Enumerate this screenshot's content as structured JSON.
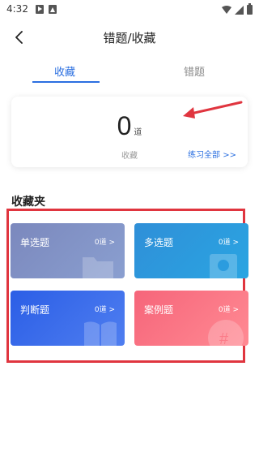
{
  "status_bar": {
    "time": "4:32",
    "icons": [
      "play-store-icon",
      "a-icon",
      "wifi-icon",
      "signal-icon",
      "battery-icon"
    ]
  },
  "header": {
    "title": "错题/收藏",
    "back_icon": "chevron-left-icon"
  },
  "tabs": [
    {
      "label": "收藏",
      "active": true
    },
    {
      "label": "错题",
      "active": false
    }
  ],
  "summary": {
    "count": "0",
    "unit": "道",
    "label": "收藏",
    "practice_all": "练习全部 >>"
  },
  "folders": {
    "title": "收藏夹",
    "items": [
      {
        "name": "单选题",
        "count": "0道",
        "chevron": ">",
        "deco_icon": "folder-icon"
      },
      {
        "name": "多选题",
        "count": "0道",
        "chevron": ">",
        "deco_icon": "certificate-icon"
      },
      {
        "name": "判断题",
        "count": "0道",
        "chevron": ">",
        "deco_icon": "book-icon"
      },
      {
        "name": "案例题",
        "count": "0道",
        "chevron": ">",
        "deco_icon": "hashtag-icon"
      }
    ]
  },
  "colors": {
    "accent": "#2b6fe0",
    "annotation_red": "#e0353f",
    "tile_single": "#7b88bd",
    "tile_multi": "#2f8fd8",
    "tile_judge": "#2b5ee6",
    "tile_case": "#f6657a"
  }
}
